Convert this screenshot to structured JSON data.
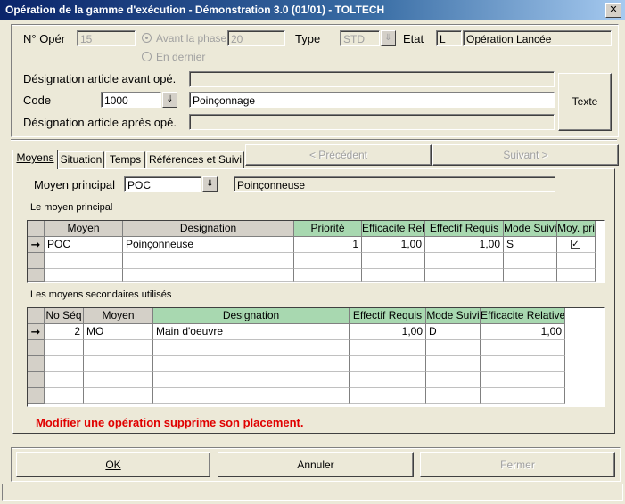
{
  "window": {
    "title": "Opération de la gamme d'exécution - Démonstration 3.0 (01/01) - TOLTECH",
    "close_glyph": "✕"
  },
  "header": {
    "num_oper_label": "N° Opér",
    "num_oper_value": "15",
    "radio_avant_label": "Avant la phase",
    "avant_value": "20",
    "radio_dernier_label": "En dernier",
    "type_label": "Type",
    "type_value": "STD",
    "etat_label": "Etat",
    "etat_code": "L",
    "etat_text": "Opération Lancée",
    "desig_avant_label": "Désignation article avant opé.",
    "desig_avant_value": "",
    "code_label": "Code",
    "code_value": "1000",
    "code_desig": "Poinçonnage",
    "desig_apres_label": "Désignation article après opé.",
    "desig_apres_value": "",
    "texte_button": "Texte"
  },
  "tabs": [
    {
      "label": "Moyens",
      "active": true
    },
    {
      "label": "Situation",
      "active": false
    },
    {
      "label": "Temps",
      "active": false
    },
    {
      "label": "Références et Suivi",
      "active": false
    }
  ],
  "nav": {
    "precedent": "< Précédent",
    "suivant": "Suivant >"
  },
  "moyens": {
    "principal_label": "Moyen principal",
    "principal_code": "POC",
    "principal_desig": "Poinçonneuse",
    "grid1_title": "Le moyen principal",
    "grid1_headers": [
      "Moyen",
      "Designation",
      "Priorité",
      "Efficacite Rela",
      "Effectif Requis",
      "Mode Suivi",
      "Moy. pri"
    ],
    "grid1_rows": [
      {
        "moyen": "POC",
        "designation": "Poinçonneuse",
        "priorite": "1",
        "efficacite": "1,00",
        "effectif": "1,00",
        "mode": "S",
        "moy_pri": true
      }
    ],
    "grid2_title": "Les moyens secondaires utilisés",
    "grid2_headers": [
      "No Séq",
      "Moyen",
      "Designation",
      "Effectif Requis",
      "Mode Suivi",
      "Efficacite Relative"
    ],
    "grid2_rows": [
      {
        "seq": "2",
        "moyen": "MO",
        "designation": "Main d'oeuvre",
        "effectif": "1,00",
        "mode": "D",
        "efficacite": "1,00"
      }
    ],
    "warning": "Modifier une opération supprime son placement."
  },
  "footer": {
    "ok": "OK",
    "annuler": "Annuler",
    "fermer": "Fermer"
  },
  "colors": {
    "header_green": "#a8d8b0",
    "warning_red": "#e00000",
    "title_blue": "#0a246a"
  }
}
